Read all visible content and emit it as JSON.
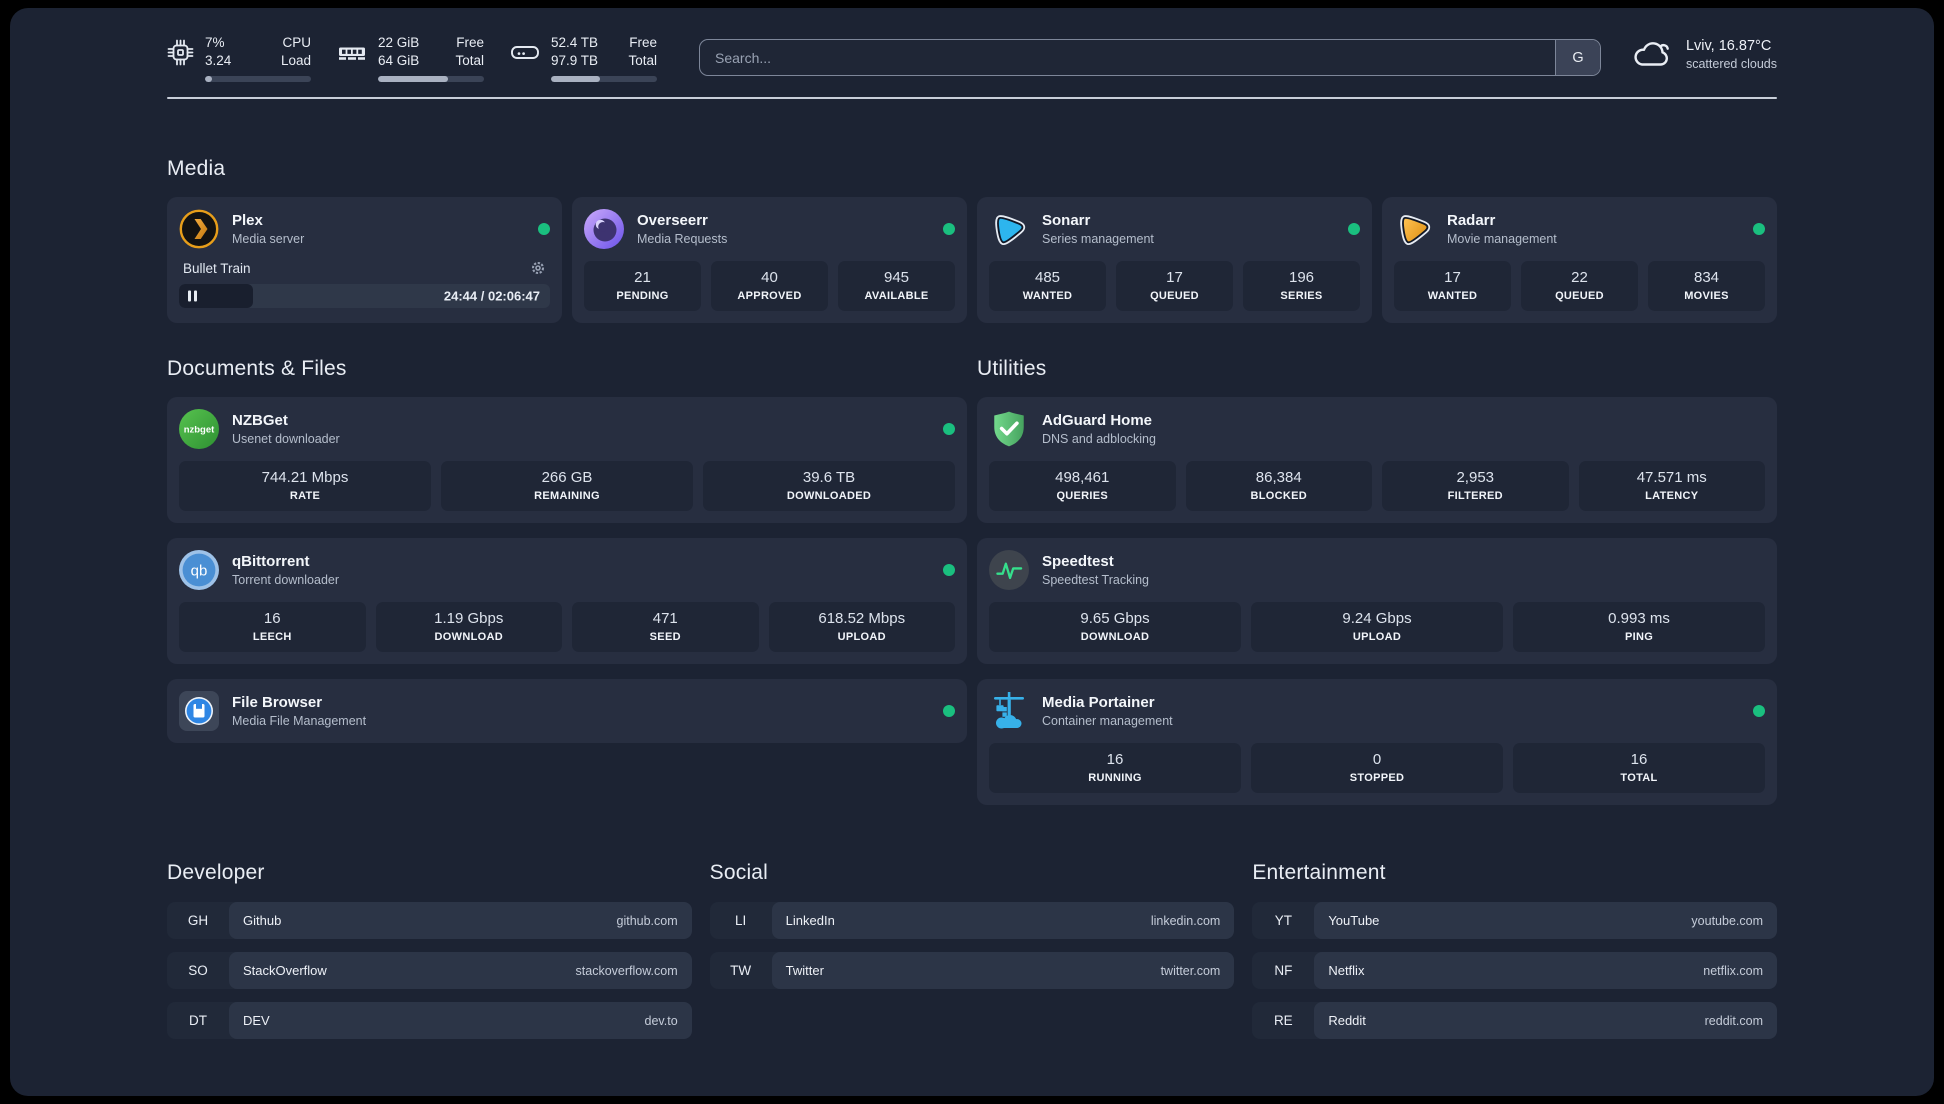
{
  "colors": {
    "page_background": "#1c2333",
    "card_background": "#272e40",
    "stat_box_background": "#1f2636",
    "status_online_green": "#1abf7f",
    "plex_orange": "#e79e1a",
    "sonarr_blue": "#2db5ee",
    "radarr_orange": "#f3a72e",
    "portainer_blue": "#37b1e9",
    "adguard_green": "#5cbf74",
    "speedtest_green": "#35e08c"
  },
  "header": {
    "metrics": [
      {
        "icon": "cpu-icon",
        "values": [
          "7%",
          "3.24"
        ],
        "labels": [
          "CPU",
          "Load"
        ],
        "progress_percent": 7
      },
      {
        "icon": "ram-icon",
        "values": [
          "22 GiB",
          "64 GiB"
        ],
        "labels": [
          "Free",
          "Total"
        ],
        "progress_percent": 66
      },
      {
        "icon": "storage-icon",
        "values": [
          "52.4 TB",
          "97.9 TB"
        ],
        "labels": [
          "Free",
          "Total"
        ],
        "progress_percent": 46
      }
    ],
    "search": {
      "placeholder": "Search...",
      "engine_button_label": "G"
    },
    "weather": {
      "icon": "cloud-icon",
      "location_temperature": "Lviv, 16.87°C",
      "condition": "scattered clouds"
    }
  },
  "sections": {
    "media": {
      "title": "Media",
      "plex": {
        "icon": "plex-icon",
        "name": "Plex",
        "description": "Media server",
        "online": true,
        "now_playing": {
          "title": "Bullet Train",
          "elapsed_total": "24:44 / 02:06:47",
          "progress_percent": 20,
          "state": "paused"
        }
      },
      "overseerr": {
        "icon": "overseerr-icon",
        "name": "Overseerr",
        "description": "Media Requests",
        "online": true,
        "stats": [
          {
            "value": "21",
            "label": "PENDING"
          },
          {
            "value": "40",
            "label": "APPROVED"
          },
          {
            "value": "945",
            "label": "AVAILABLE"
          }
        ]
      },
      "sonarr": {
        "icon": "sonarr-icon",
        "name": "Sonarr",
        "description": "Series management",
        "online": true,
        "stats": [
          {
            "value": "485",
            "label": "WANTED"
          },
          {
            "value": "17",
            "label": "QUEUED"
          },
          {
            "value": "196",
            "label": "SERIES"
          }
        ]
      },
      "radarr": {
        "icon": "radarr-icon",
        "name": "Radarr",
        "description": "Movie management",
        "online": true,
        "stats": [
          {
            "value": "17",
            "label": "WANTED"
          },
          {
            "value": "22",
            "label": "QUEUED"
          },
          {
            "value": "834",
            "label": "MOVIES"
          }
        ]
      }
    },
    "documents": {
      "title": "Documents & Files",
      "nzbget": {
        "icon": "nzbget-icon",
        "name": "NZBGet",
        "description": "Usenet downloader",
        "online": true,
        "stats": [
          {
            "value": "744.21 Mbps",
            "label": "RATE"
          },
          {
            "value": "266 GB",
            "label": "REMAINING"
          },
          {
            "value": "39.6 TB",
            "label": "DOWNLOADED"
          }
        ]
      },
      "qbittorrent": {
        "icon": "qbittorrent-icon",
        "name": "qBittorrent",
        "description": "Torrent downloader",
        "online": true,
        "stats": [
          {
            "value": "16",
            "label": "LEECH"
          },
          {
            "value": "1.19 Gbps",
            "label": "DOWNLOAD"
          },
          {
            "value": "471",
            "label": "SEED"
          },
          {
            "value": "618.52 Mbps",
            "label": "UPLOAD"
          }
        ]
      },
      "filebrowser": {
        "icon": "filebrowser-icon",
        "name": "File Browser",
        "description": "Media File Management",
        "online": true
      }
    },
    "utilities": {
      "title": "Utilities",
      "adguard": {
        "icon": "adguard-icon",
        "name": "AdGuard Home",
        "description": "DNS and adblocking",
        "online": false,
        "stats": [
          {
            "value": "498,461",
            "label": "QUERIES"
          },
          {
            "value": "86,384",
            "label": "BLOCKED"
          },
          {
            "value": "2,953",
            "label": "FILTERED"
          },
          {
            "value": "47.571 ms",
            "label": "LATENCY"
          }
        ]
      },
      "speedtest": {
        "icon": "speedtest-icon",
        "name": "Speedtest",
        "description": "Speedtest Tracking",
        "online": false,
        "stats": [
          {
            "value": "9.65 Gbps",
            "label": "DOWNLOAD"
          },
          {
            "value": "9.24 Gbps",
            "label": "UPLOAD"
          },
          {
            "value": "0.993 ms",
            "label": "PING"
          }
        ]
      },
      "portainer": {
        "icon": "portainer-icon",
        "name": "Media Portainer",
        "description": "Container management",
        "online": true,
        "stats": [
          {
            "value": "16",
            "label": "RUNNING"
          },
          {
            "value": "0",
            "label": "STOPPED"
          },
          {
            "value": "16",
            "label": "TOTAL"
          }
        ]
      }
    },
    "links": {
      "developer": {
        "title": "Developer",
        "items": [
          {
            "abbr": "GH",
            "name": "Github",
            "url": "github.com"
          },
          {
            "abbr": "SO",
            "name": "StackOverflow",
            "url": "stackoverflow.com"
          },
          {
            "abbr": "DT",
            "name": "DEV",
            "url": "dev.to"
          }
        ]
      },
      "social": {
        "title": "Social",
        "items": [
          {
            "abbr": "LI",
            "name": "LinkedIn",
            "url": "linkedin.com"
          },
          {
            "abbr": "TW",
            "name": "Twitter",
            "url": "twitter.com"
          }
        ]
      },
      "entertainment": {
        "title": "Entertainment",
        "items": [
          {
            "abbr": "YT",
            "name": "YouTube",
            "url": "youtube.com"
          },
          {
            "abbr": "NF",
            "name": "Netflix",
            "url": "netflix.com"
          },
          {
            "abbr": "RE",
            "name": "Reddit",
            "url": "reddit.com"
          }
        ]
      }
    }
  }
}
